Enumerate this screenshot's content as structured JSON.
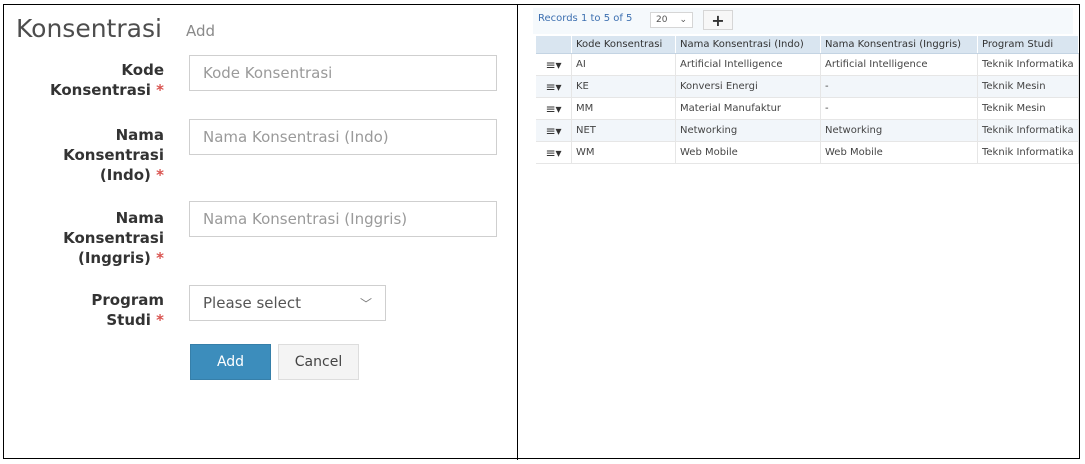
{
  "form": {
    "title": "Konsentrasi",
    "subtitle": "Add",
    "fields": [
      {
        "label_lines": [
          "Kode",
          "Konsentrasi"
        ],
        "placeholder": "Kode Konsentrasi"
      },
      {
        "label_lines": [
          "Nama",
          "Konsentrasi",
          "(Indo)"
        ],
        "placeholder": "Nama Konsentrasi (Indo)"
      },
      {
        "label_lines": [
          "Nama",
          "Konsentrasi",
          "(Inggris)"
        ],
        "placeholder": "Nama Konsentrasi (Inggris)"
      },
      {
        "label_lines": [
          "Program",
          "Studi"
        ]
      }
    ],
    "required_mark": "*",
    "select_value": "Please select",
    "add_label": "Add",
    "cancel_label": "Cancel"
  },
  "grid": {
    "records_text": "Records 1 to 5 of 5",
    "page_size": "20",
    "add_symbol": "+",
    "menu_symbol": "≡▾",
    "columns": [
      "Kode Konsentrasi",
      "Nama Konsentrasi (Indo)",
      "Nama Konsentrasi (Inggris)",
      "Program Studi"
    ],
    "rows": [
      [
        "AI",
        "Artificial Intelligence",
        "Artificial Intelligence",
        "Teknik Informatika"
      ],
      [
        "KE",
        "Konversi Energi",
        "-",
        "Teknik Mesin"
      ],
      [
        "MM",
        "Material Manufaktur",
        "-",
        "Teknik Mesin"
      ],
      [
        "NET",
        "Networking",
        "Networking",
        "Teknik Informatika"
      ],
      [
        "WM",
        "Web Mobile",
        "Web Mobile",
        "Teknik Informatika"
      ]
    ]
  },
  "colors": {
    "primary": "#3c8dbc",
    "required": "#d9534f",
    "header_bg": "#d9e5f0",
    "link": "#3c6fb0"
  }
}
